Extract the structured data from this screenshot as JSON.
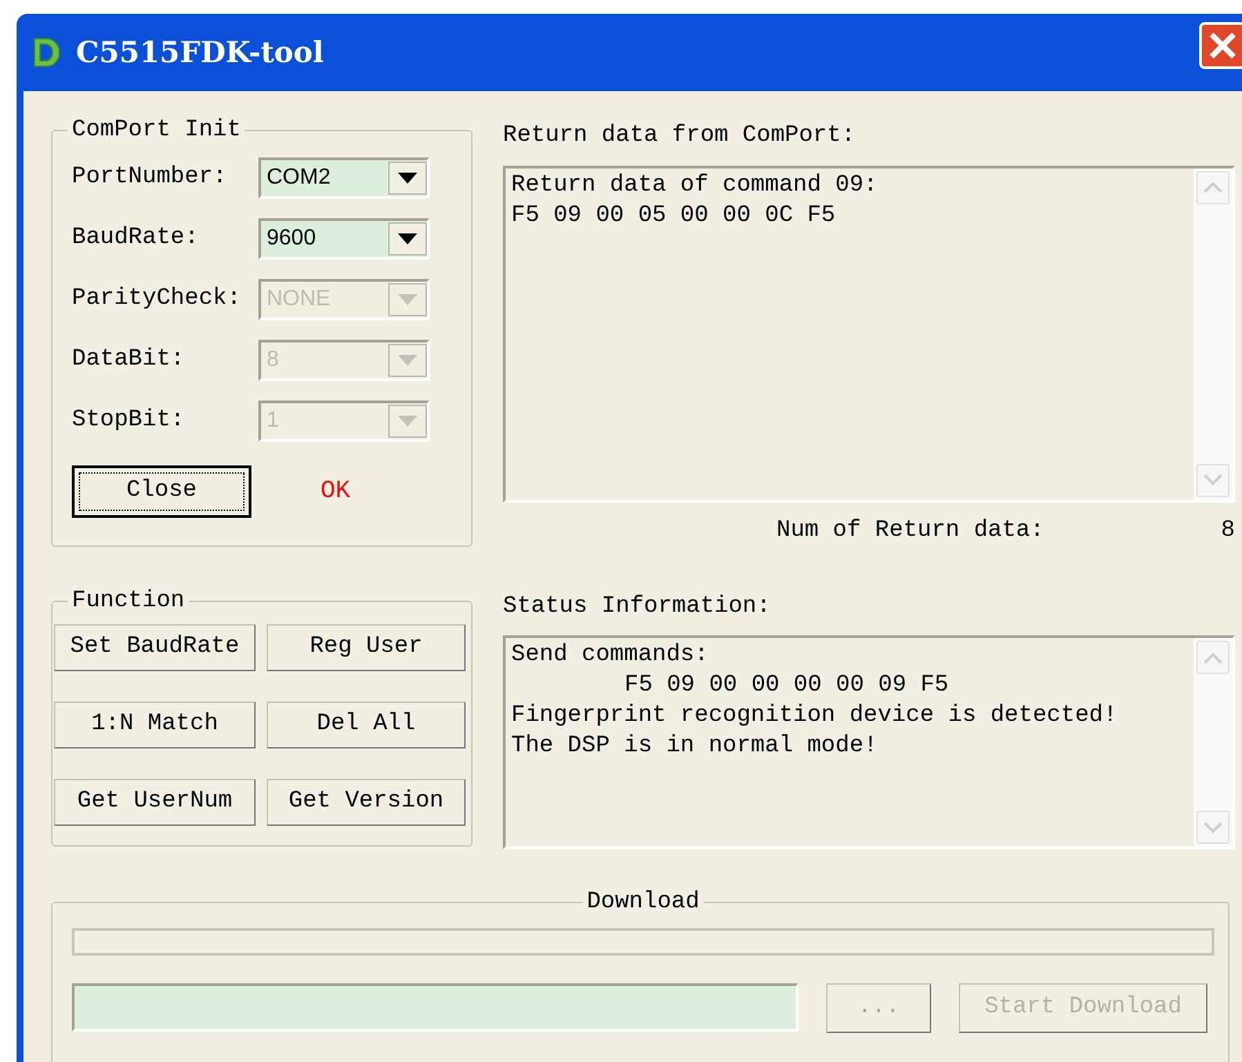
{
  "window": {
    "title": "C5515FDK-tool"
  },
  "comport_init": {
    "title": "ComPort Init",
    "fields": [
      {
        "label": "PortNumber:",
        "value": "COM2",
        "disabled": false
      },
      {
        "label": "BaudRate:",
        "value": "9600",
        "disabled": false
      },
      {
        "label": "ParityCheck:",
        "value": "NONE",
        "disabled": true
      },
      {
        "label": "DataBit:",
        "value": "8",
        "disabled": true
      },
      {
        "label": "StopBit:",
        "value": "1",
        "disabled": true
      }
    ],
    "close_button": "Close",
    "status": "OK"
  },
  "return_data": {
    "label": "Return data from ComPort:",
    "lines": [
      "Return data of command 09:",
      "F5 09 00 05 00 00 0C F5"
    ],
    "count_label": "Num of Return data:",
    "count": "8"
  },
  "function": {
    "title": "Function",
    "buttons": [
      "Set BaudRate",
      "Reg User",
      "1:N Match",
      "Del All",
      "Get UserNum",
      "Get Version"
    ]
  },
  "status_info": {
    "label": "Status Information:",
    "lines": [
      {
        "text": "Send commands:",
        "indented": false
      },
      {
        "text": "F5 09 00 00 00 00 09 F5",
        "indented": true
      },
      {
        "text": "Fingerprint recognition device is detected!",
        "indented": false
      },
      {
        "text": "The DSP is in normal mode!",
        "indented": false
      }
    ]
  },
  "download": {
    "title": "Download",
    "level": 0,
    "browse_button": "...",
    "start_button": "Start Download",
    "start_disabled": true
  }
}
